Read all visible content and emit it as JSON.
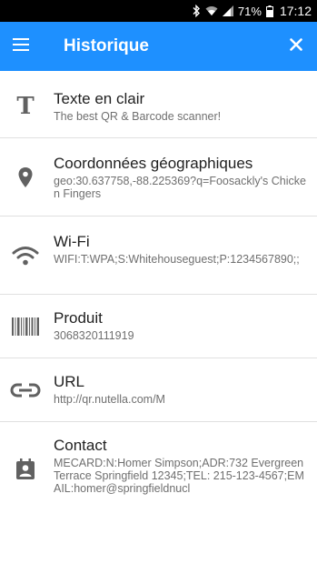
{
  "status_bar": {
    "battery": "71%",
    "time": "17:12",
    "icons": [
      "bluetooth-icon",
      "wifi-icon",
      "signal-icon",
      "battery-icon"
    ]
  },
  "app_bar": {
    "title": "Historique",
    "background_color": "#1e90ff",
    "menu_icon": "hamburger-menu-icon",
    "close_icon": "close-icon"
  },
  "history": [
    {
      "type": "Texte en clair",
      "icon": "text-format-icon",
      "content": "The best QR & Barcode scanner!"
    },
    {
      "type": "Coordonnées géographiques",
      "icon": "location-pin-icon",
      "content": "geo:30.637758,-88.225369?q=Foosackly's Chicken Fingers"
    },
    {
      "type": "Wi-Fi",
      "icon": "wifi-icon",
      "content": "WIFI:T:WPA;S:Whitehouseguest;P:1234567890;;"
    },
    {
      "type": "Produit",
      "icon": "barcode-icon",
      "content": "3068320111919"
    },
    {
      "type": "URL",
      "icon": "link-icon",
      "content": "http://qr.nutella.com/M"
    },
    {
      "type": "Contact",
      "icon": "contact-card-icon",
      "content": "MECARD:N:Homer Simpson;ADR:732 Evergreen Terrace Springfield 12345;TEL: 215-123-4567;EMAIL:homer@springfieldnucl"
    }
  ]
}
